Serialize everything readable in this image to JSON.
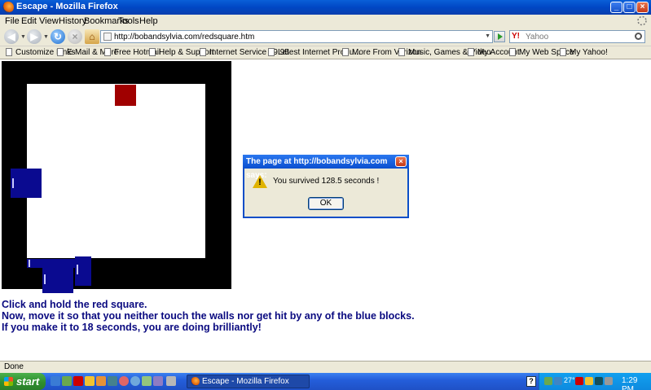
{
  "window": {
    "title": "Escape - Mozilla Firefox",
    "controls": {
      "minimize": "_",
      "maximize": "□",
      "close": "×"
    }
  },
  "menu": [
    "File",
    "Edit",
    "View",
    "History",
    "Bookmarks",
    "Tools",
    "Help"
  ],
  "navigation": {
    "url": "http://bobandsylvia.com/redsquare.htm",
    "search_placeholder": "Yahoo",
    "search_engine_icon": "Y!",
    "icons": [
      "back-icon",
      "forward-icon",
      "reload-icon",
      "stop-icon",
      "home-icon",
      "go-icon",
      "magnifier-icon"
    ]
  },
  "bookmarks": [
    "Customize Links",
    "E-Mail & More",
    "Free Hotmail",
    "Help & Support",
    "Internet Service $9.95",
    "Latest Internet Produ...",
    "More From Verizon",
    "Music, Games & Video",
    "My Account",
    "My Web Space",
    "My Yahoo!"
  ],
  "game": {
    "instructions": [
      "Click and hold the red square.",
      "Now, move it so that you neither touch the walls nor get hit by any of the blue blocks.",
      "If you make it to 18 seconds, you are doing brilliantly!"
    ],
    "colors": {
      "wall": "#000000",
      "field": "#ffffff",
      "player": "#a00000",
      "enemy": "#0a0a90",
      "text": "#0a0a80"
    }
  },
  "dialog": {
    "title": "The page at http://bobandsylvia.com says:",
    "message": "You survived 128.5 seconds !",
    "ok_label": "OK",
    "icon": "warning-icon",
    "close_glyph": "×"
  },
  "status": {
    "text": "Done"
  },
  "taskbar": {
    "start_label": "start",
    "task_label": "Escape - Mozilla Firefox",
    "clock": "1:29 PM",
    "help_glyph": "?",
    "temperature": "27°"
  }
}
